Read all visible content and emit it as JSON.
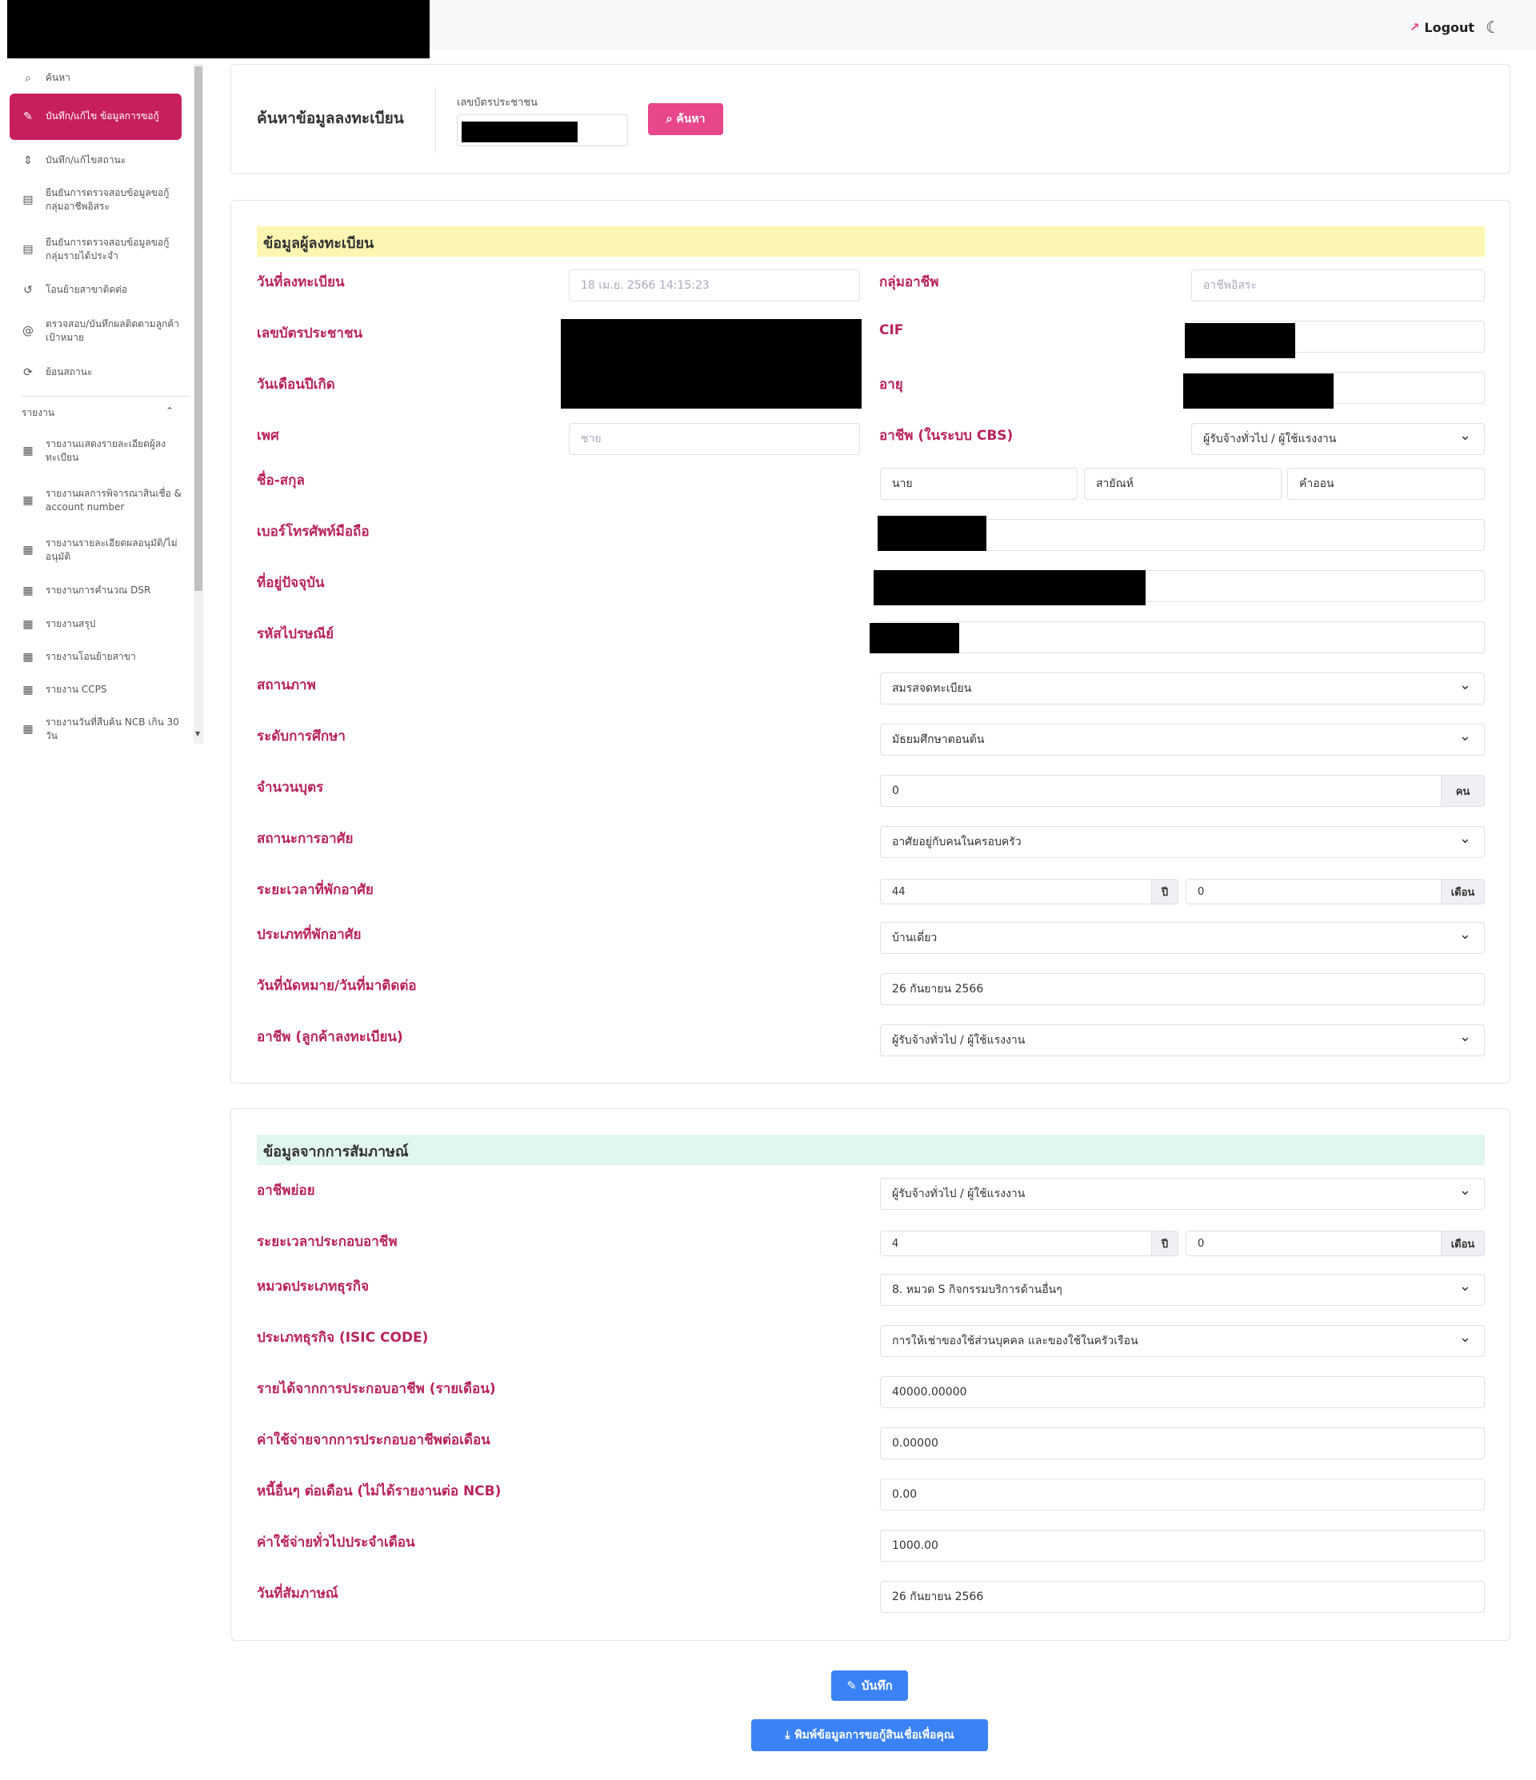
{
  "header": {
    "logout_label": "Logout",
    "logout_icon": "external-link-icon",
    "theme_icon": "moon-icon"
  },
  "sidebar": {
    "items": [
      {
        "label": "ค้นหา",
        "icon": "search-icon"
      },
      {
        "label": "บันทึก/แก้ไข ข้อมูลการขอกู้",
        "icon": "edit-icon"
      },
      {
        "label": "บันทึก/แก้ไขสถานะ",
        "icon": "sort-icon"
      },
      {
        "label": "ยืนยันการตรวจสอบข้อมูลขอกู้ กลุ่มอาชีพอิสระ",
        "icon": "calendar-icon"
      },
      {
        "label": "ยืนยันการตรวจสอบข้อมูลขอกู้ กลุ่มรายได้ประจำ",
        "icon": "calendar-icon"
      },
      {
        "label": "โอนย้ายสาขาติดต่อ",
        "icon": "history-icon"
      },
      {
        "label": "ตรวจสอบ/บันทึกผลติดตามลูกค้าเป้าหมาย",
        "icon": "at-icon"
      },
      {
        "label": "ย้อนสถานะ",
        "icon": "refresh-icon"
      }
    ],
    "section_label": "รายงาน",
    "reports": [
      {
        "label": "รายงานแสดงรายละเอียดผู้ลงทะเบียน",
        "icon": "chart-icon"
      },
      {
        "label": "รายงานผลการพิจารณาสินเชื่อ & account number",
        "icon": "chart-icon"
      },
      {
        "label": "รายงานรายละเอียดผลอนุมัติ/ไม่อนุมัติ",
        "icon": "chart-icon"
      },
      {
        "label": "รายงานการคำนวณ DSR",
        "icon": "chart-icon"
      },
      {
        "label": "รายงานสรุป",
        "icon": "chart-icon"
      },
      {
        "label": "รายงานโอนย้ายสาขา",
        "icon": "chart-icon"
      },
      {
        "label": "รายงาน CCPS",
        "icon": "chart-icon"
      },
      {
        "label": "รายงานวันที่สืบค้น NCB เกิน 30 วัน",
        "icon": "chart-icon"
      }
    ]
  },
  "search": {
    "title": "ค้นหาข้อมูลลงทะเบียน",
    "field_label": "เลขบัตรประชาชน",
    "button_label": "ค้นหา"
  },
  "registrant": {
    "title": "ข้อมูลผู้ลงทะเบียน",
    "reg_date_label": "วันที่ลงทะเบียน",
    "reg_date_value": "18 เม.ย. 2566 14:15:23",
    "occupation_group_label": "กลุ่มอาชีพ",
    "occupation_group_value": "อาชีพอิสระ",
    "id_card_label": "เลขบัตรประชาชน",
    "cif_label": "CIF",
    "dob_label": "วันเดือนปีเกิด",
    "age_label": "อายุ",
    "gender_label": "เพศ",
    "gender_value": "ชาย",
    "occupation_cbs_label": "อาชีพ (ในระบบ CBS)",
    "occupation_cbs_value": "ผู้รับจ้างทั่วไป / ผู้ใช้แรงงาน",
    "name_label": "ชื่อ-สกุล",
    "title_value": "นาย",
    "first_name": "สายัณห์",
    "last_name": "คำออน",
    "phone_label": "เบอร์โทรศัพท์มือถือ",
    "address_label": "ที่อยู่ปัจจุบัน",
    "postcode_label": "รหัสไปรษณีย์",
    "marital_label": "สถานภาพ",
    "marital_value": "สมรสจดทะเบียน",
    "education_label": "ระดับการศึกษา",
    "education_value": "มัธยมศึกษาตอนต้น",
    "children_label": "จำนวนบุตร",
    "children_value": "0",
    "children_unit": "คน",
    "residence_status_label": "สถานะการอาศัย",
    "residence_status_value": "อาศัยอยู่กับคนในครอบครัว",
    "residence_duration_label": "ระยะเวลาที่พักอาศัย",
    "residence_years": "44",
    "years_unit": "ปี",
    "residence_months": "0",
    "months_unit": "เดือน",
    "residence_type_label": "ประเภทที่พักอาศัย",
    "residence_type_value": "บ้านเดี่ยว",
    "appointment_label": "วันที่นัดหมาย/วันที่มาติดต่อ",
    "appointment_value": "26 กันยายน 2566",
    "occupation_reg_label": "อาชีพ (ลูกค้าลงทะเบียน)",
    "occupation_reg_value": "ผู้รับจ้างทั่วไป / ผู้ใช้แรงงาน"
  },
  "interview": {
    "title": "ข้อมูลจากการสัมภาษณ์",
    "sub_occupation_label": "อาชีพย่อย",
    "sub_occupation_value": "ผู้รับจ้างทั่วไป / ผู้ใช้แรงงาน",
    "work_duration_label": "ระยะเวลาประกอบอาชีพ",
    "work_years": "4",
    "years_unit": "ปี",
    "work_months": "0",
    "months_unit": "เดือน",
    "business_category_label": "หมวดประเภทธุรกิจ",
    "business_category_value": "8. หมวด S กิจกรรมบริการด้านอื่นๆ",
    "isic_label": "ประเภทธุรกิจ (ISIC CODE)",
    "isic_value": "การให้เช่าของใช้ส่วนบุคคล และของใช้ในครัวเรือน",
    "income_label": "รายได้จากการประกอบอาชีพ (รายเดือน)",
    "income_value": "40000.00000",
    "business_expense_label": "ค่าใช้จ่ายจากการประกอบอาชีพต่อเดือน",
    "business_expense_value": "0.00000",
    "other_debt_label": "หนี้อื่นๆ ต่อเดือน (ไม่ได้รายงานต่อ NCB)",
    "other_debt_value": "0.00",
    "general_expense_label": "ค่าใช้จ่ายทั่วไปประจำเดือน",
    "general_expense_value": "1000.00",
    "interview_date_label": "วันที่สัมภาษณ์",
    "interview_date_value": "26 กันยายน 2566"
  },
  "actions": {
    "save_label": "บันทึก",
    "print_label": "พิมพ์ข้อมูลการขอกู้สินเชื่อเพื่อคุณ"
  }
}
